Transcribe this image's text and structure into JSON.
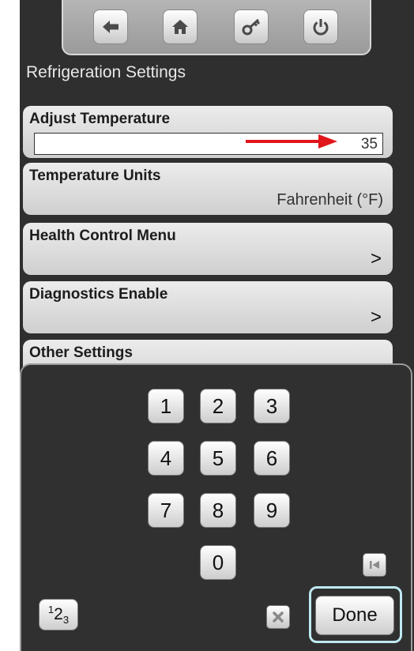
{
  "header": {
    "title": "Refrigeration Settings",
    "nav_buttons": [
      {
        "icon": "back-arrow-icon"
      },
      {
        "icon": "home-icon"
      },
      {
        "icon": "key-icon"
      },
      {
        "icon": "power-icon"
      }
    ]
  },
  "settings": {
    "adjust_temperature": {
      "label": "Adjust Temperature",
      "value": "35"
    },
    "temperature_units": {
      "label": "Temperature Units",
      "value": "Fahrenheit (°F)"
    },
    "health_control": {
      "label": "Health Control Menu",
      "chevron": ">"
    },
    "diagnostics": {
      "label": "Diagnostics Enable",
      "chevron": ">"
    },
    "other": {
      "label": "Other Settings",
      "chevron": ">"
    }
  },
  "keypad": {
    "keys": [
      "1",
      "2",
      "3",
      "4",
      "5",
      "6",
      "7",
      "8",
      "9",
      "0"
    ],
    "done_label": "Done",
    "mode_key": {
      "base": "1",
      "mid": "2",
      "sub": "3"
    },
    "clear_icon": "clear-x-icon",
    "backspace_icon": "skip-back-icon"
  },
  "colors": {
    "background": "#2f2f2f",
    "row": "#e2e2e2",
    "highlight_arrow": "#e0161b",
    "done_outline": "#bfe9f2"
  }
}
